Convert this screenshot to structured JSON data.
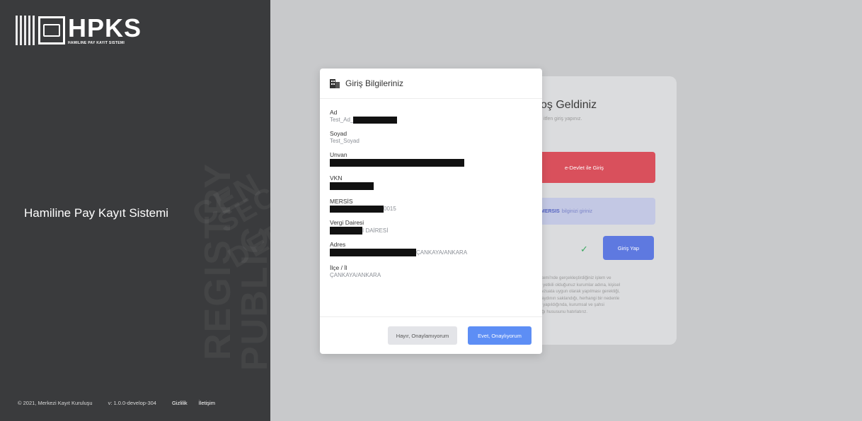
{
  "brand": {
    "logo_title": "HPKS",
    "logo_subtitle": "HAMILINE PAY KAYIT SISTEMI",
    "app_name": "Hamiline Pay Kayıt Sistemi",
    "watermark_lines": [
      "REGISTRY",
      "PUBLIC",
      "CEN",
      "SEC",
      "DEP"
    ]
  },
  "footer": {
    "copyright": "© 2021, Merkezi Kayıt Kuruluşu",
    "version": "v: 1.0.0-develop-304",
    "privacy_link": "Gizlilik",
    "contact_link": "İletişim"
  },
  "login_card": {
    "welcome": "oş Geldiniz",
    "hint": "itfen giriş yapınız.",
    "edevlet_button": "e-Devlet ile Giriş",
    "mersis_bold": "MERSIS",
    "mersis_rest": "bilginizi giriniz",
    "submit_button": "Giriş Yap",
    "info_lines": [
      "stemi'nde gerçekleştirdiğiniz işlem ve",
      "e yetkili olduğunuz kurumlar adına, kişisel",
      "evzuata uygun olarak yapılması gerektiği,",
      "kaydının saklandığı, herhangi bir nedenle",
      "n yapıldığında, kurumsal ve şahsi",
      "ağı hususunu hatırlatırız."
    ]
  },
  "modal": {
    "title": "Giriş Bilgileriniz",
    "fields": [
      {
        "label": "Ad",
        "value_prefix": "Test_Ad_",
        "value_suffix": ""
      },
      {
        "label": "Soyad",
        "value_prefix": "Test_Soyad",
        "value_suffix": ""
      },
      {
        "label": "Unvan",
        "value_prefix": "",
        "value_suffix": ""
      },
      {
        "label": "VKN",
        "value_prefix": "",
        "value_suffix": ""
      },
      {
        "label": "MERSİS",
        "value_prefix": "",
        "value_suffix": "0015"
      },
      {
        "label": "Vergi Dairesi",
        "value_prefix": "",
        "value_suffix": "I DAİRESİ"
      },
      {
        "label": "Adres",
        "value_prefix": "",
        "value_suffix": "ÇANKAYA/ANKARA"
      },
      {
        "label": "İlçe / İl",
        "value_prefix": "ÇANKAYA/ANKARA",
        "value_suffix": ""
      }
    ],
    "reject_button": "Hayır, Onaylamıyorum",
    "accept_button": "Evet, Onaylıyorum"
  },
  "colors": {
    "sidebar_bg": "#3a3b3d",
    "edevlet_red": "#d9505c",
    "accept_blue": "#5d8ef5",
    "submit_blue": "#5e79e0"
  }
}
